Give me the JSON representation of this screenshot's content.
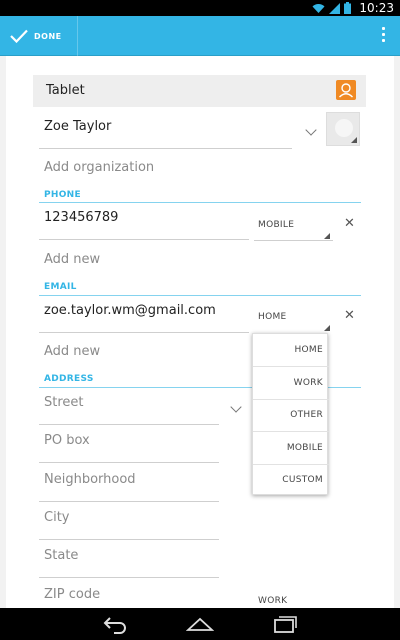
{
  "status_bar": {
    "time": "10:23",
    "icons": [
      "wifi-icon",
      "signal-icon",
      "battery-icon"
    ]
  },
  "action_bar": {
    "done_label": "DONE",
    "accent": "#33b5e5"
  },
  "account": {
    "label": "Tablet"
  },
  "name": {
    "value": "Zoe Taylor"
  },
  "organization": {
    "placeholder": "Add organization"
  },
  "phone": {
    "section_label": "PHONE",
    "value": "123456789",
    "type": "MOBILE",
    "add_label": "Add new"
  },
  "email": {
    "section_label": "EMAIL",
    "value": "zoe.taylor.wm@gmail.com",
    "type": "HOME",
    "add_label": "Add new"
  },
  "address": {
    "section_label": "ADDRESS",
    "street": "Street",
    "po_box": "PO box",
    "neighborhood": "Neighborhood",
    "city": "City",
    "state": "State",
    "zip": "ZIP code",
    "type": "WORK"
  },
  "type_dropdown": {
    "options": [
      "HOME",
      "WORK",
      "OTHER",
      "MOBILE",
      "CUSTOM"
    ]
  }
}
